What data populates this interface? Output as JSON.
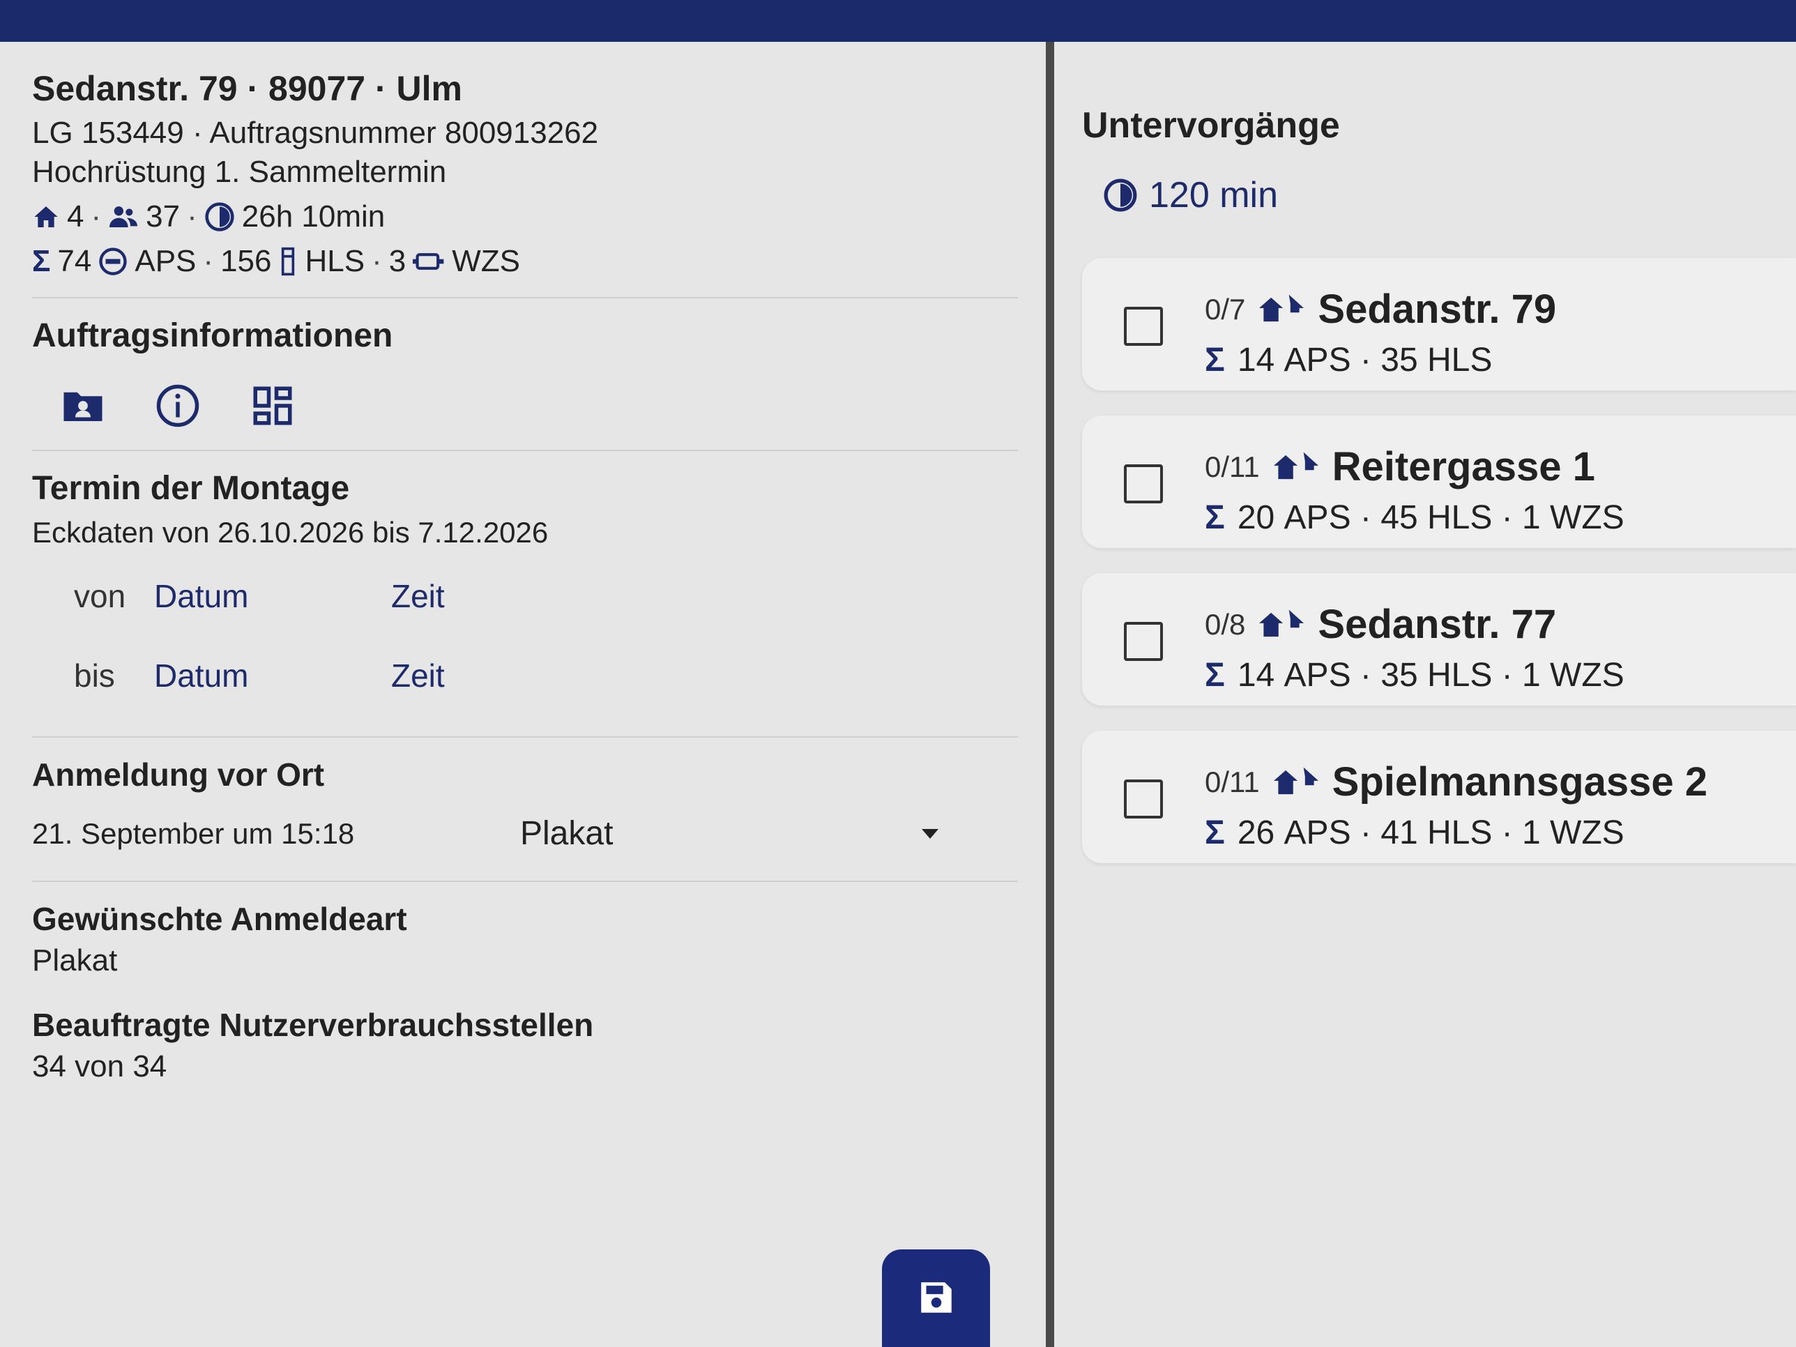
{
  "header": {
    "address": "Sedanstr. 79 · 89077 · Ulm",
    "order": "LG 153449 · Auftragsnummer 800913262",
    "type": "Hochrüstung 1. Sammeltermin"
  },
  "stats1": {
    "units": "4",
    "persons": "37",
    "duration": "26h 10min"
  },
  "stats2": {
    "sigma": "Σ",
    "total": "74",
    "aps_label": "APS",
    "hls_count": "156",
    "hls_label": "HLS",
    "wzs_count": "3",
    "wzs_label": "WZS"
  },
  "auftrag": {
    "title": "Auftragsinformationen"
  },
  "termin": {
    "title": "Termin der Montage",
    "subtitle": "Eckdaten von 26.10.2026 bis 7.12.2026",
    "von_label": "von",
    "bis_label": "bis",
    "datum": "Datum",
    "zeit": "Zeit"
  },
  "anmeldung": {
    "title": "Anmeldung vor Ort",
    "date": "21. September um 15:18",
    "selected": "Plakat"
  },
  "gewuenscht": {
    "title": "Gewünschte Anmeldeart",
    "value": "Plakat"
  },
  "beauftragt": {
    "title": "Beauftragte Nutzerverbrauchsstellen",
    "value": "34 von 34"
  },
  "right": {
    "title": "Untervorgänge",
    "duration": "120 min",
    "cards": [
      {
        "count": "0/7",
        "name": "Sedanstr. 79",
        "sum": "14 APS · 35 HLS"
      },
      {
        "count": "0/11",
        "name": "Reitergasse 1",
        "sum": "20 APS · 45 HLS · 1 WZS"
      },
      {
        "count": "0/8",
        "name": "Sedanstr. 77",
        "sum": "14 APS · 35 HLS · 1 WZS"
      },
      {
        "count": "0/11",
        "name": "Spielmannsgasse 2",
        "sum": "26 APS · 41 HLS · 1 WZS"
      }
    ]
  },
  "colors": {
    "accent": "#1d2a6b",
    "button": "#1b2a7b"
  }
}
